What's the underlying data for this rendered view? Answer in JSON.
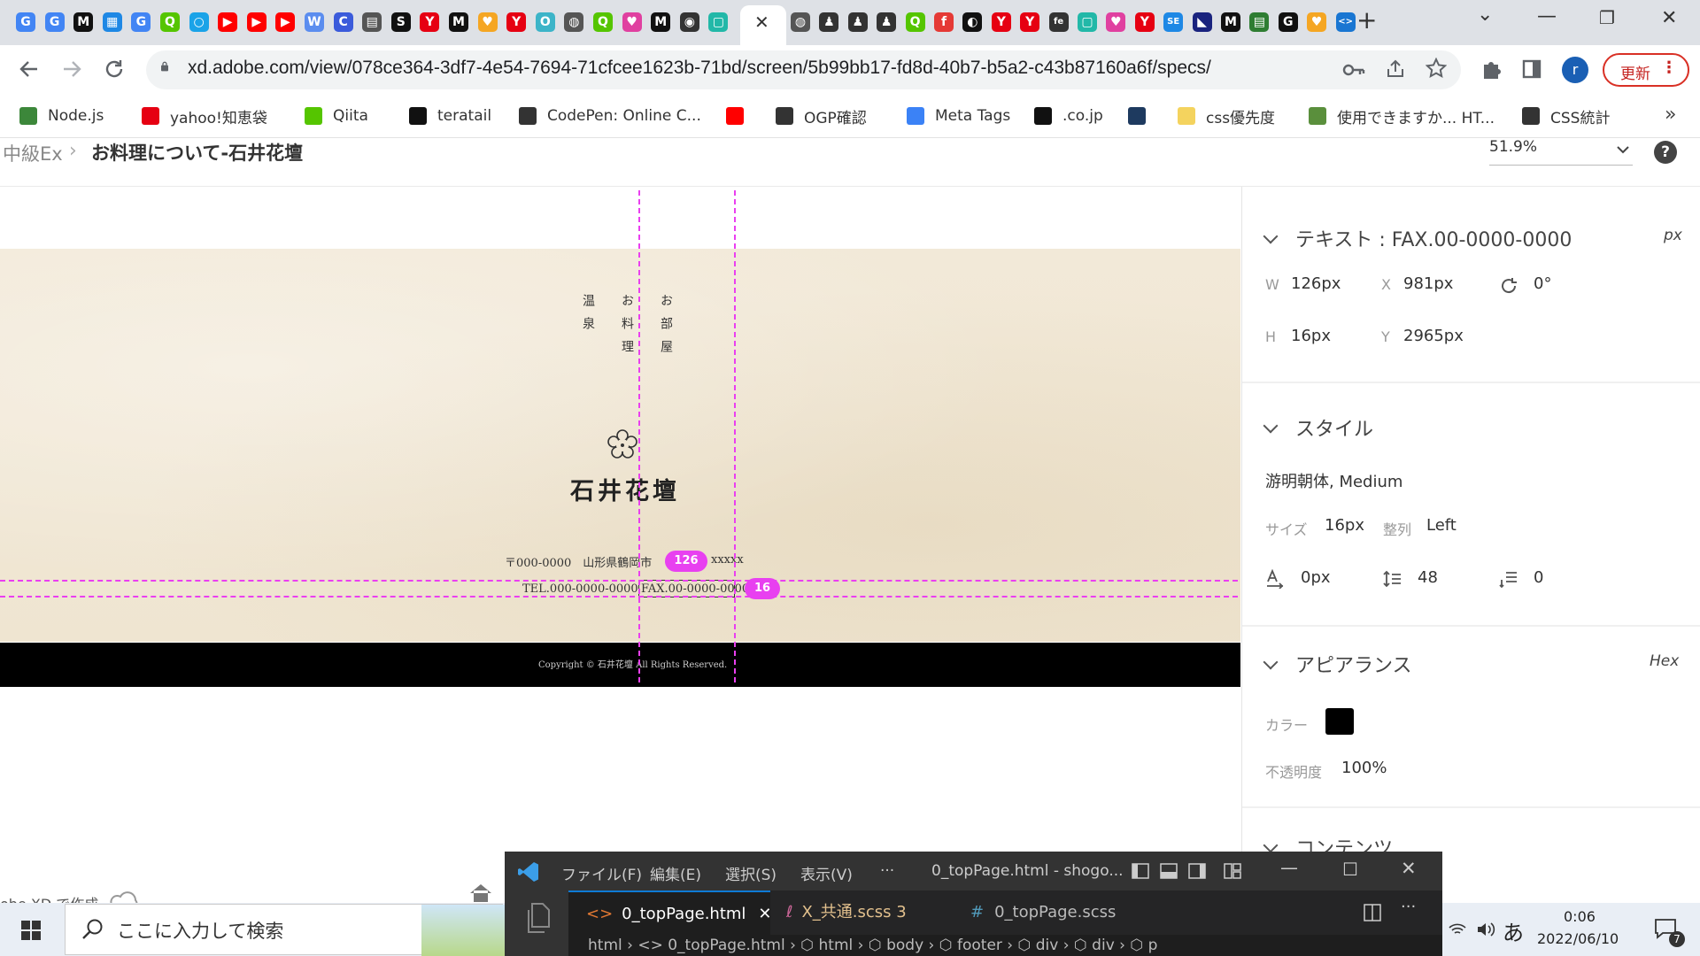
{
  "browser": {
    "favicons": [
      {
        "glyph": "G",
        "color": "#4285f4"
      },
      {
        "glyph": "G",
        "color": "#4285f4"
      },
      {
        "glyph": "M",
        "color": "#111111"
      },
      {
        "glyph": "▦",
        "color": "#1e88e5"
      },
      {
        "glyph": "G",
        "color": "#4285f4"
      },
      {
        "glyph": "Q",
        "color": "#55c500"
      },
      {
        "glyph": "○",
        "color": "#1aa3e8"
      },
      {
        "glyph": "▶",
        "color": "#ff0000"
      },
      {
        "glyph": "▶",
        "color": "#ff0000"
      },
      {
        "glyph": "▶",
        "color": "#ff0000"
      },
      {
        "glyph": "W",
        "color": "#5b8def"
      },
      {
        "glyph": "C",
        "color": "#3b5bdb"
      },
      {
        "glyph": "▤",
        "color": "#555555"
      },
      {
        "glyph": "S",
        "color": "#111111"
      },
      {
        "glyph": "Y",
        "color": "#e60012"
      },
      {
        "glyph": "M",
        "color": "#111111"
      },
      {
        "glyph": "♥",
        "color": "#f5a623"
      },
      {
        "glyph": "Y",
        "color": "#e60012"
      },
      {
        "glyph": "O",
        "color": "#3cb4c8"
      },
      {
        "glyph": "◍",
        "color": "#555555"
      },
      {
        "glyph": "Q",
        "color": "#55c500"
      },
      {
        "glyph": "♥",
        "color": "#e040a0"
      },
      {
        "glyph": "M",
        "color": "#111111"
      },
      {
        "glyph": "◉",
        "color": "#333333"
      },
      {
        "glyph": "▢",
        "color": "#22b8a8"
      }
    ],
    "favicons_after": [
      {
        "glyph": "◍",
        "color": "#555555"
      },
      {
        "glyph": "♟",
        "color": "#333333"
      },
      {
        "glyph": "♟",
        "color": "#333333"
      },
      {
        "glyph": "♟",
        "color": "#333333"
      },
      {
        "glyph": "Q",
        "color": "#55c500"
      },
      {
        "glyph": "f",
        "color": "#e53935"
      },
      {
        "glyph": "◐",
        "color": "#111111"
      },
      {
        "glyph": "Y",
        "color": "#e60012"
      },
      {
        "glyph": "Y",
        "color": "#e60012"
      },
      {
        "glyph": "fe",
        "color": "#333333"
      },
      {
        "glyph": "▢",
        "color": "#22b8a8"
      },
      {
        "glyph": "♥",
        "color": "#e040a0"
      },
      {
        "glyph": "Y",
        "color": "#e60012"
      },
      {
        "glyph": "SE",
        "color": "#1e88e5"
      },
      {
        "glyph": "◣",
        "color": "#1a237e"
      },
      {
        "glyph": "M",
        "color": "#111111"
      },
      {
        "glyph": "▤",
        "color": "#2e7d32"
      },
      {
        "glyph": "G",
        "color": "#111111"
      },
      {
        "glyph": "♥",
        "color": "#f5a623"
      },
      {
        "glyph": "<>",
        "color": "#1976d2"
      }
    ],
    "active_tab_close": "✕",
    "new_tab": "+",
    "window_controls": {
      "dropdown": "⌄",
      "minimize": "—",
      "restore": "❐",
      "close": "✕"
    },
    "url": "xd.adobe.com/view/078ce364-3df7-4e54-7694-71cfcee1623b-71bd/screen/5b99bb17-fd8d-40b7-b5a2-c43b87160a6f/specs/",
    "update_label": "更新",
    "avatar_initial": "r",
    "bookmarks": [
      {
        "label": "Node.js",
        "color": "#3c873a"
      },
      {
        "label": "yahoo!知恵袋",
        "color": "#e60012"
      },
      {
        "label": "Qiita",
        "color": "#55c500"
      },
      {
        "label": "teratail",
        "color": "#111111"
      },
      {
        "label": "CodePen: Online C...",
        "color": "#333333"
      },
      {
        "label": "",
        "color": "#ff0000"
      },
      {
        "label": "OGP確認",
        "color": "#333333"
      },
      {
        "label": "Meta Tags",
        "color": "#3b82f6"
      },
      {
        "label": ".co.jp",
        "color": "#111111"
      },
      {
        "label": "",
        "color": "#1e3a5f"
      },
      {
        "label": "css優先度",
        "color": "#f4d35e"
      },
      {
        "label": "使用できますか... HT...",
        "color": "#5a8f3c"
      },
      {
        "label": "CSS統計",
        "color": "#333333"
      }
    ],
    "bookmarks_more": "»"
  },
  "xd": {
    "breadcrumb_root": "中級Ex",
    "breadcrumb_sep": "›",
    "page_title": "お料理について-石井花壇",
    "zoom": "51.9%",
    "help": "?",
    "xd_credit": "obe XD で作成"
  },
  "artboard": {
    "vertical_cols": [
      "お部屋",
      "お料理",
      "温泉"
    ],
    "brand": "石井花壇",
    "address_line": "〒000-0000　山形県鶴岡市",
    "address_tail": "xxxxx",
    "tel": "TEL.000-0000-0000",
    "fax": "FAX.00-0000-0000",
    "copyright": "Copyright © 石井花壇 All Rights Reserved.",
    "badge_width": "126",
    "badge_height": "16"
  },
  "spec": {
    "text_heading": "テキスト : FAX.00-0000-0000",
    "unit": "px",
    "w_label": "W",
    "w_value": "126px",
    "x_label": "X",
    "x_value": "981px",
    "rotation_value": "0°",
    "h_label": "H",
    "h_value": "16px",
    "y_label": "Y",
    "y_value": "2965px",
    "style_heading": "スタイル",
    "font": "游明朝体, Medium",
    "size_label": "サイズ",
    "size_value": "16px",
    "align_label": "整列",
    "align_value": "Left",
    "letter_spacing_value": "0px",
    "line_height_value": "48",
    "paragraph_value": "0",
    "appearance_heading": "アピアランス",
    "color_format": "Hex",
    "color_label": "カラー",
    "color_value": "#000000",
    "opacity_label": "不透明度",
    "opacity_value": "100%",
    "content_heading": "コンテンツ"
  },
  "vscode": {
    "menus": [
      "ファイル(F)",
      "編集(E)",
      "選択(S)",
      "表示(V)",
      "···"
    ],
    "window_title": "0_topPage.html - shogo...",
    "tabs": [
      {
        "label": "0_topPage.html",
        "color": "#ffffff",
        "close": "✕"
      },
      {
        "label": "X_共通.scss 3",
        "color": "#e2c08d"
      },
      {
        "label": "0_topPage.scss",
        "color": "#bbbbbb"
      }
    ],
    "tab_more": "···",
    "breadcrumb": "html  ›  <> 0_topPage.html  ›  ⬡ html  ›  ⬡ body  ›  ⬡ footer  ›  ⬡ div  ›  ⬡ div  ›  ⬡ p"
  },
  "taskbar": {
    "search_placeholder": "ここに入力して検索",
    "ime": "あ",
    "time": "0:06",
    "date": "2022/06/10",
    "notification_count": "7"
  }
}
